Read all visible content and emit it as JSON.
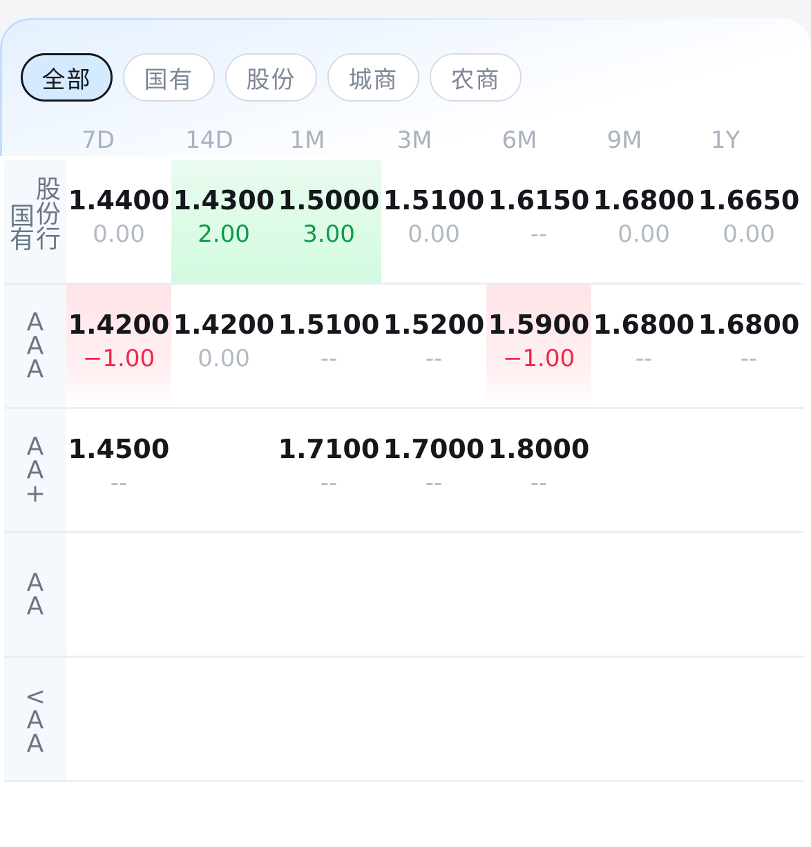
{
  "filters": [
    "全部",
    "国有",
    "股份",
    "城商",
    "农商"
  ],
  "active_filter": 0,
  "columns": [
    "7D",
    "14D",
    "1M",
    "3M",
    "6M",
    "9M",
    "1Y"
  ],
  "rows": [
    {
      "label_left": "国有",
      "label_right": "股份行",
      "cells": [
        {
          "rate": "1.4400",
          "change": "0.00",
          "trend": "flat"
        },
        {
          "rate": "1.4300",
          "change": "2.00",
          "trend": "up"
        },
        {
          "rate": "1.5000",
          "change": "3.00",
          "trend": "up"
        },
        {
          "rate": "1.5100",
          "change": "0.00",
          "trend": "flat"
        },
        {
          "rate": "1.6150",
          "change": "--",
          "trend": "flat"
        },
        {
          "rate": "1.6800",
          "change": "0.00",
          "trend": "flat"
        },
        {
          "rate": "1.6650",
          "change": "0.00",
          "trend": "flat"
        }
      ]
    },
    {
      "label": "AAA",
      "cells": [
        {
          "rate": "1.4200",
          "change": "−1.00",
          "trend": "down"
        },
        {
          "rate": "1.4200",
          "change": "0.00",
          "trend": "flat"
        },
        {
          "rate": "1.5100",
          "change": "--",
          "trend": "flat"
        },
        {
          "rate": "1.5200",
          "change": "--",
          "trend": "flat"
        },
        {
          "rate": "1.5900",
          "change": "−1.00",
          "trend": "down"
        },
        {
          "rate": "1.6800",
          "change": "--",
          "trend": "flat"
        },
        {
          "rate": "1.6800",
          "change": "--",
          "trend": "flat"
        }
      ]
    },
    {
      "label": "AA+",
      "cells": [
        {
          "rate": "1.4500",
          "change": "--",
          "trend": "flat"
        },
        null,
        {
          "rate": "1.7100",
          "change": "--",
          "trend": "flat"
        },
        {
          "rate": "1.7000",
          "change": "--",
          "trend": "flat"
        },
        {
          "rate": "1.8000",
          "change": "--",
          "trend": "flat"
        },
        null,
        null
      ]
    },
    {
      "label": "AA",
      "cells": [
        null,
        null,
        null,
        null,
        null,
        null,
        null
      ]
    },
    {
      "label": "<AA",
      "cells": [
        null,
        null,
        null,
        null,
        null,
        null,
        null
      ]
    }
  ],
  "colors": {
    "up": "#0e9a4b",
    "down": "#ef2747",
    "flat": "#b3bac4",
    "active_chip_bg": "#d4eaff"
  }
}
